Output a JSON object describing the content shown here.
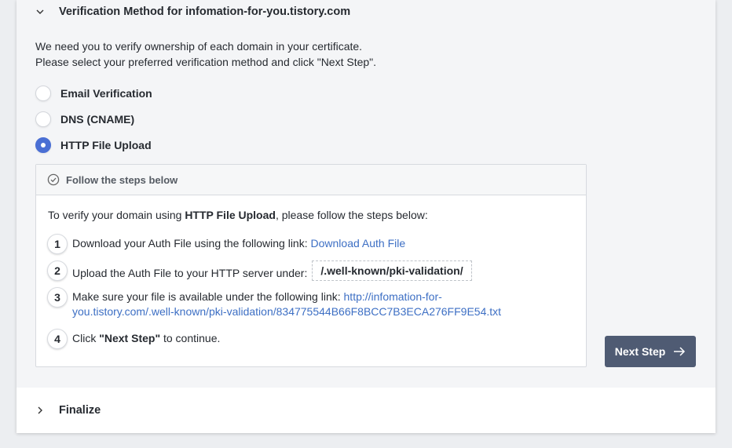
{
  "verification": {
    "title": "Verification Method for infomation-for-you.tistory.com",
    "intro_line1": "We need you to verify ownership of each domain in your certificate.",
    "intro_line2": "Please select your preferred verification method and click \"Next Step\".",
    "options": [
      {
        "label": "Email Verification",
        "checked": false
      },
      {
        "label": "DNS (CNAME)",
        "checked": false
      },
      {
        "label": "HTTP File Upload",
        "checked": true
      }
    ],
    "steps_panel": {
      "header": "Follow the steps below",
      "intro_pre": "To verify your domain using ",
      "intro_bold": "HTTP File Upload",
      "intro_post": ", please follow the steps below:",
      "steps": [
        {
          "num": "1",
          "text": "Download your Auth File using the following link: ",
          "link": "Download Auth File"
        },
        {
          "num": "2",
          "text": "Upload the Auth File to your HTTP server under:",
          "path": "/.well-known/pki-validation/"
        },
        {
          "num": "3",
          "text": "Make sure your file is available under the following link: ",
          "link_line1": "http://infomation-for-",
          "link_line2": "you.tistory.com/.well-known/pki-validation/834775544B66F8BCC7B3ECA276FF9E54.txt"
        },
        {
          "num": "4",
          "pre": "Click ",
          "bold": "\"Next Step\"",
          "post": " to continue."
        }
      ]
    },
    "next_button": "Next Step"
  },
  "finalize": {
    "title": "Finalize"
  },
  "colors": {
    "accent": "#4a6fd4",
    "link": "#3d6fc4",
    "button": "#4f5b73"
  }
}
